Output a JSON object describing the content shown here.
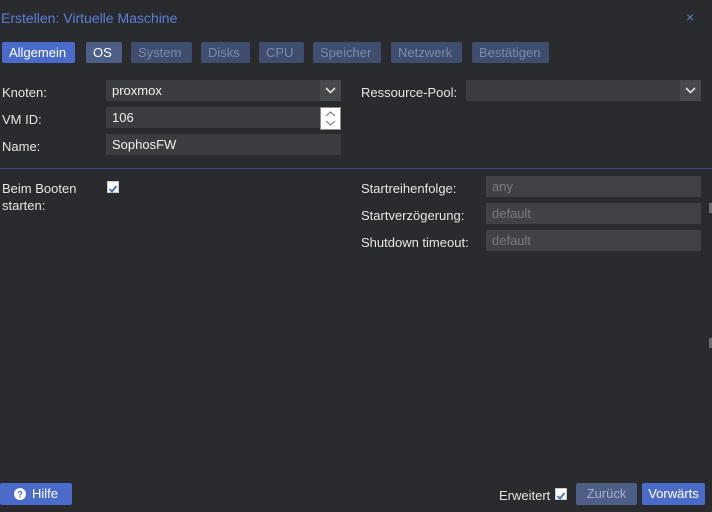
{
  "window": {
    "title": "Erstellen: Virtuelle Maschine"
  },
  "tabs": [
    "Allgemein",
    "OS",
    "System",
    "Disks",
    "CPU",
    "Speicher",
    "Netzwerk",
    "Bestätigen"
  ],
  "form": {
    "node_label": "Knoten:",
    "node_value": "proxmox",
    "vmid_label": "VM ID:",
    "vmid_value": "106",
    "name_label": "Name:",
    "name_value": "SophosFW",
    "pool_label": "Ressource-Pool:",
    "pool_value": "",
    "onboot_label_line1": "Beim Booten",
    "onboot_label_line2": "starten:",
    "onboot_checked": true,
    "startup_order_label": "Startreihenfolge:",
    "startup_order_placeholder": "any",
    "startup_delay_label": "Startverzögerung:",
    "startup_delay_placeholder": "default",
    "shutdown_timeout_label": "Shutdown timeout:",
    "shutdown_timeout_placeholder": "default"
  },
  "footer": {
    "help_label": "Hilfe",
    "advanced_label": "Erweitert",
    "advanced_checked": true,
    "back_label": "Zurück",
    "next_label": "Vorwärts"
  },
  "icons": {
    "close": "close-icon",
    "help": "question-circle-icon",
    "combo": "chevron-down-icon",
    "check": "checkmark-icon"
  },
  "colors": {
    "accent": "#4a6bc9",
    "title": "#5b7fd6",
    "background": "#2a2b2f"
  }
}
